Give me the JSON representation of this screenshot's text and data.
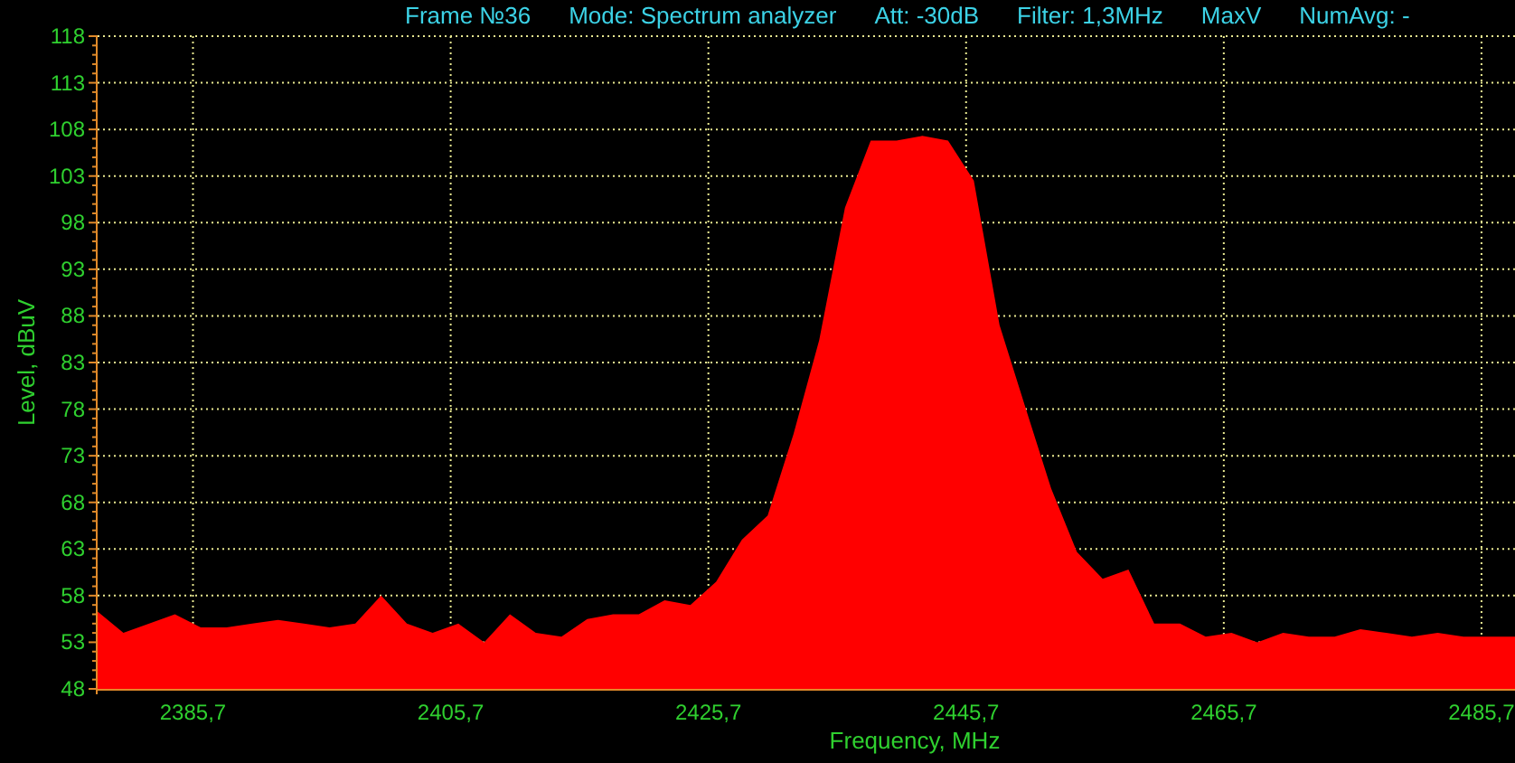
{
  "header": [
    "Frame №36",
    "Mode: Spectrum analyzer",
    "Att: -30dB",
    "Filter: 1,3MHz"
  ],
  "header_tail": [
    "NumAvg: -"
  ],
  "chart_data": {
    "type": "area",
    "grid": true,
    "xlabel": "Frequency, MHz",
    "ylabel": "Level, dBuV",
    "x": [
      2378.3,
      2380.3,
      2382.3,
      2384.3,
      2386.3,
      2388.3,
      2390.3,
      2392.3,
      2394.3,
      2396.3,
      2398.3,
      2400.3,
      2402.3,
      2404.3,
      2406.3,
      2408.3,
      2410.3,
      2412.3,
      2414.3,
      2416.3,
      2418.3,
      2420.3,
      2422.3,
      2424.3,
      2426.3,
      2428.3,
      2430.3,
      2432.3,
      2434.3,
      2436.3,
      2438.3,
      2440.3,
      2442.3,
      2444.3,
      2446.3,
      2448.3,
      2450.3,
      2452.3,
      2454.3,
      2456.3,
      2458.3,
      2460.3,
      2462.3,
      2464.3,
      2466.3,
      2468.3,
      2470.3,
      2472.3,
      2474.3,
      2476.3,
      2478.3,
      2480.3,
      2482.3,
      2484.3,
      2486.3,
      2488.3
    ],
    "series": [
      {
        "name": "MaxV",
        "color": "#ff0000",
        "values": [
          56.3,
          54,
          55,
          56,
          54.6,
          54.6,
          55,
          55.4,
          55,
          54.6,
          55,
          58,
          55,
          54,
          55,
          53,
          56,
          54,
          53.6,
          55.5,
          56,
          56,
          57.5,
          57,
          59.5,
          64,
          66.6,
          75.3,
          85.4,
          99.6,
          106.8,
          106.8,
          107.3,
          106.8,
          102.5,
          87,
          78.2,
          69.5,
          62.7,
          59.8,
          60.8,
          55,
          55,
          53.6,
          54,
          53,
          54,
          53.6,
          53.6,
          54.4,
          54,
          53.6,
          54,
          53.6,
          53.6,
          53.6
        ]
      }
    ],
    "xlim": [
      2378.3,
      2488.3
    ],
    "ylim": [
      48,
      118
    ],
    "xticks": [
      {
        "value": 2385.7,
        "label": "2385,7"
      },
      {
        "value": 2405.7,
        "label": "2405,7"
      },
      {
        "value": 2425.7,
        "label": "2425,7"
      },
      {
        "value": 2445.7,
        "label": "2445,7"
      },
      {
        "value": 2465.7,
        "label": "2465,7"
      },
      {
        "value": 2485.7,
        "label": "2485,7"
      }
    ],
    "yticks": [
      48,
      53,
      58,
      63,
      68,
      73,
      78,
      83,
      88,
      93,
      98,
      103,
      108,
      113,
      118
    ]
  }
}
